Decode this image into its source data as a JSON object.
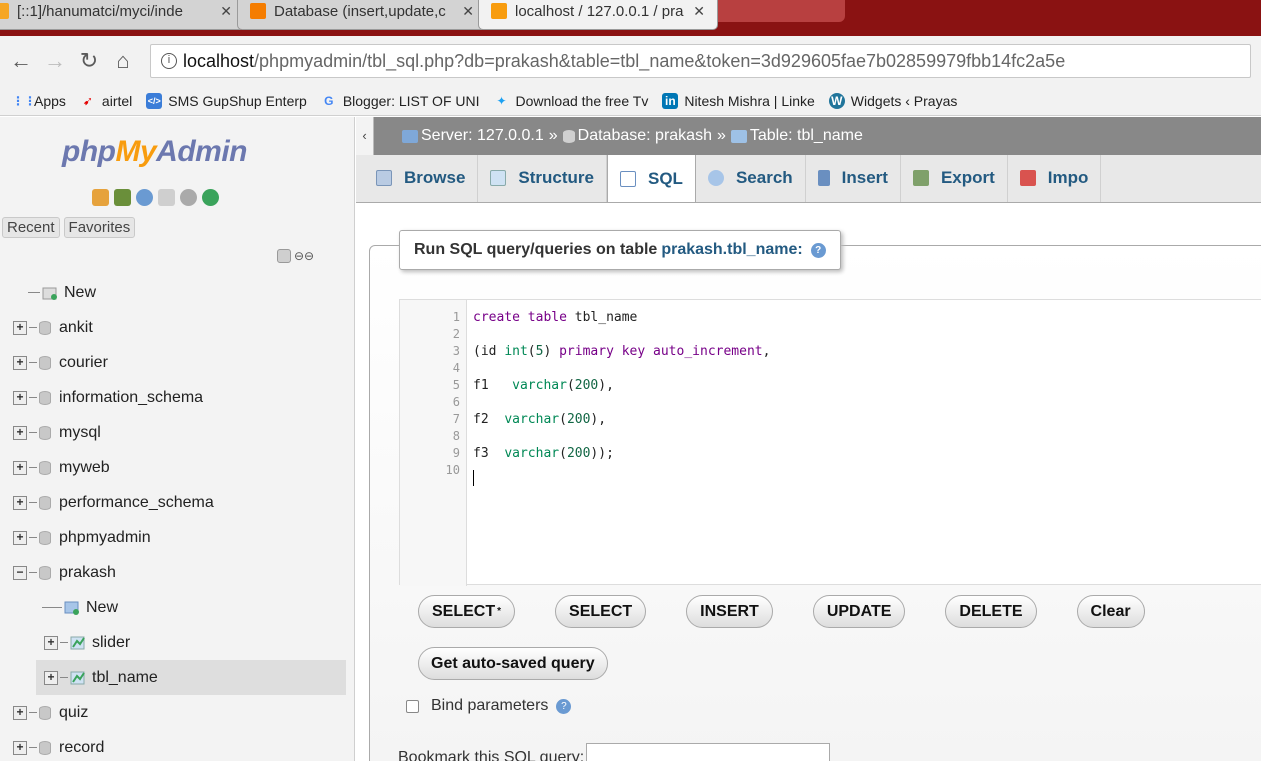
{
  "browser": {
    "tabs": [
      {
        "title": "[::1]/hanumatci/myci/inde",
        "favicon_color": "#f6a623"
      },
      {
        "title": "Database (insert,update,c",
        "favicon_color": "#f57d00"
      },
      {
        "title": "localhost / 127.0.0.1 / pra",
        "favicon_color": "#f89c0e"
      }
    ],
    "url_host": "localhost",
    "url_path": "/phpmyadmin/tbl_sql.php?db=prakash&table=tbl_name&token=3d929605fae7b02859979fbb14fc2a5e",
    "bookmarks": [
      {
        "label": "Apps",
        "icon": "apps-grid-icon",
        "color": "#4285f4"
      },
      {
        "label": "airtel",
        "icon": "airtel-icon",
        "color": "#e40000"
      },
      {
        "label": "SMS GupShup Enterp",
        "icon": "gupshup-icon",
        "color": "#3b7dd8"
      },
      {
        "label": "Blogger: LIST OF UNI",
        "icon": "google-icon",
        "color": "#4285f4"
      },
      {
        "label": "Download the free Tv",
        "icon": "twitter-icon",
        "color": "#1da1f2"
      },
      {
        "label": "Nitesh Mishra | Linke",
        "icon": "linkedin-icon",
        "color": "#0077b5"
      },
      {
        "label": "Widgets ‹ Prayas",
        "icon": "wordpress-icon",
        "color": "#21759b"
      }
    ]
  },
  "sidebar": {
    "logo": {
      "php": "php",
      "my": "My",
      "admin": "Admin"
    },
    "recent": "Recent",
    "favorites": "Favorites",
    "tree": [
      {
        "label": "New",
        "type": "new"
      },
      {
        "label": "ankit",
        "type": "db"
      },
      {
        "label": "courier",
        "type": "db"
      },
      {
        "label": "information_schema",
        "type": "db"
      },
      {
        "label": "mysql",
        "type": "db"
      },
      {
        "label": "myweb",
        "type": "db"
      },
      {
        "label": "performance_schema",
        "type": "db"
      },
      {
        "label": "phpmyadmin",
        "type": "db"
      },
      {
        "label": "prakash",
        "type": "db-open"
      },
      {
        "label": "New",
        "type": "child-new"
      },
      {
        "label": "slider",
        "type": "child-table"
      },
      {
        "label": "tbl_name",
        "type": "child-table-selected"
      },
      {
        "label": "quiz",
        "type": "db"
      },
      {
        "label": "record",
        "type": "db"
      }
    ]
  },
  "breadcrumb": {
    "server": "Server: 127.0.0.1",
    "sep": "»",
    "database": "Database: prakash",
    "table": "Table: tbl_name"
  },
  "tabs": [
    {
      "label": "Browse",
      "icon": "browse-icon"
    },
    {
      "label": "Structure",
      "icon": "structure-icon"
    },
    {
      "label": "SQL",
      "icon": "sql-icon",
      "active": true
    },
    {
      "label": "Search",
      "icon": "search-icon"
    },
    {
      "label": "Insert",
      "icon": "insert-icon"
    },
    {
      "label": "Export",
      "icon": "export-icon"
    },
    {
      "label": "Impo",
      "icon": "import-icon"
    }
  ],
  "query_panel": {
    "legend_prefix": "Run SQL query/queries on table",
    "legend_table": "prakash.tbl_name:",
    "code_lines": [
      "create table tbl_name",
      "",
      "(id int(5) primary key auto_increment,",
      "",
      "f1   varchar(200),",
      "",
      "f2  varchar(200),",
      "",
      "f3  varchar(200));",
      ""
    ],
    "buttons": [
      "SELECT",
      "SELECT",
      "INSERT",
      "UPDATE",
      "DELETE",
      "Clear"
    ],
    "first_button_suffix": "*",
    "autosave_button": "Get auto-saved query",
    "bind_parameters": "Bind parameters",
    "bookmark_label": "Bookmark this SQL query:"
  }
}
